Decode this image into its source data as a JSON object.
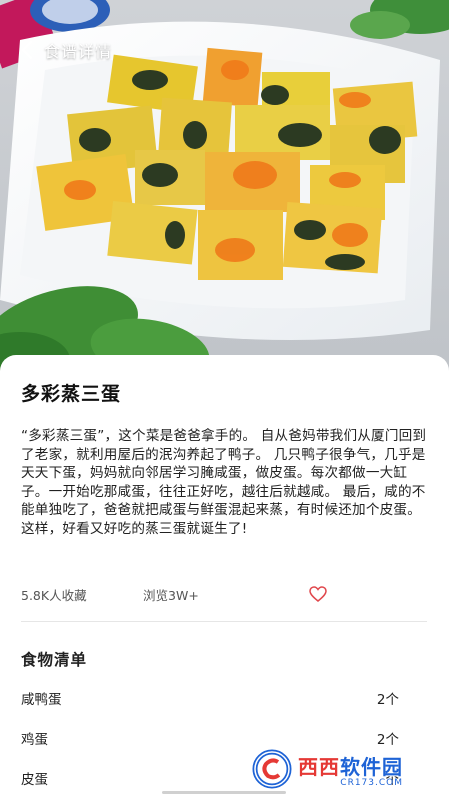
{
  "header": {
    "title": "食谱详情"
  },
  "recipe": {
    "title": "多彩蒸三蛋",
    "description": "“多彩蒸三蛋”，这个菜是爸爸拿手的。 自从爸妈带我们从厦门回到了老家，就利用屋后的泯沟养起了鸭子。 几只鸭子很争气，几乎是天天下蛋，妈妈就向邻居学习腌咸蛋，做皮蛋。每次都做一大缸子。一开始吃那咸蛋，往往正好吃，越往后就越咸。 最后，咸的不能单独吃了，爸爸就把咸蛋与鲜蛋混起来蒸，有时候还加个皮蛋。 这样，好看又好吃的蒸三蛋就诞生了!",
    "favorites": "5.8K人收藏",
    "views": "浏览3W+"
  },
  "ingredients": {
    "title": "食物清单",
    "items": [
      {
        "name": "咸鸭蛋",
        "qty": "2个"
      },
      {
        "name": "鸡蛋",
        "qty": "2个"
      },
      {
        "name": "皮蛋",
        "qty": "个"
      }
    ]
  },
  "watermark": {
    "brand_red": "西西",
    "brand_blue": "软件园",
    "domain": "CR173.COM"
  },
  "colors": {
    "accent_heart": "#e0474c",
    "watermark_red": "#e53935",
    "watermark_blue": "#1e63d6"
  }
}
